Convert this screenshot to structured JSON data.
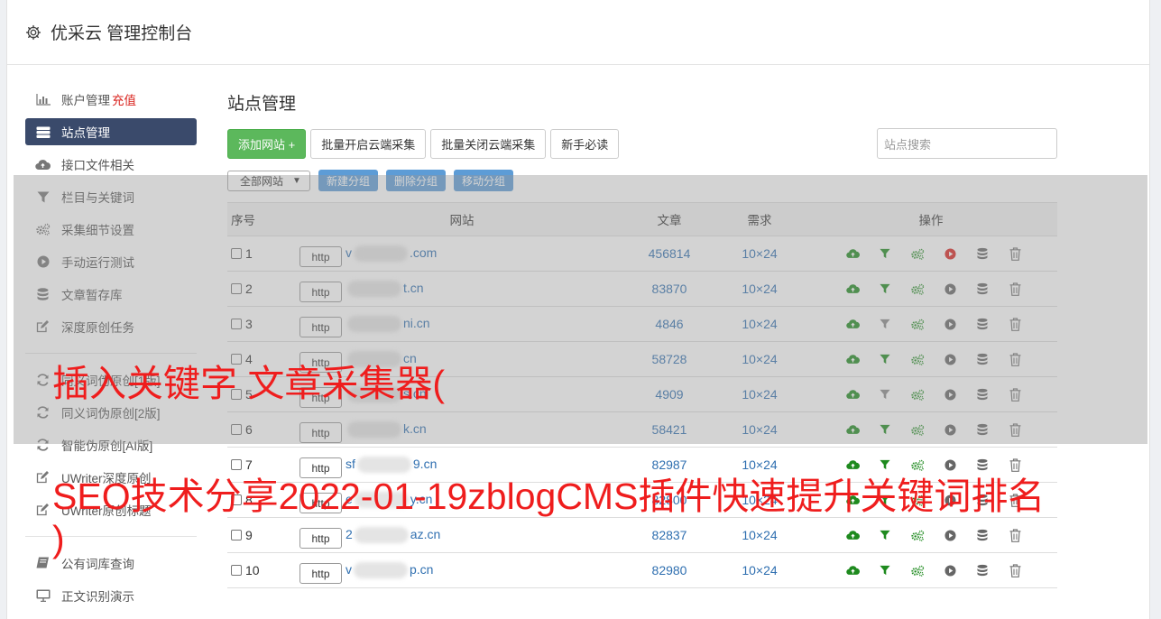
{
  "header": {
    "title": "优采云 管理控制台"
  },
  "sidebar": {
    "items": [
      {
        "label": "账户管理",
        "extra": "充值",
        "icon": "bar-chart-icon"
      },
      {
        "label": "站点管理",
        "icon": "server-icon",
        "active": true
      },
      {
        "label": "接口文件相关",
        "icon": "cloud-upload-icon"
      },
      {
        "label": "栏目与关键词",
        "icon": "filter-icon"
      },
      {
        "label": "采集细节设置",
        "icon": "cogs-icon"
      },
      {
        "label": "手动运行测试",
        "icon": "play-circle-icon"
      },
      {
        "label": "文章暂存库",
        "icon": "database-icon"
      },
      {
        "label": "深度原创任务",
        "icon": "edit-icon"
      }
    ],
    "items2": [
      {
        "label": "同义词伪原创[1版]",
        "icon": "refresh-icon"
      },
      {
        "label": "同义词伪原创[2版]",
        "icon": "refresh-icon"
      },
      {
        "label": "智能伪原创[AI版]",
        "icon": "refresh-icon"
      },
      {
        "label": "UWriter深度原创",
        "icon": "edit-icon"
      },
      {
        "label": "UWriter原创标题",
        "icon": "edit-icon"
      }
    ],
    "items3": [
      {
        "label": "公有词库查询",
        "icon": "book-icon"
      },
      {
        "label": "正文识别演示",
        "icon": "monitor-icon"
      }
    ]
  },
  "main": {
    "title": "站点管理",
    "toolbar": {
      "add_site": "添加网站 +",
      "batch_open": "批量开启云端采集",
      "batch_close": "批量关闭云端采集",
      "newbie": "新手必读",
      "search_placeholder": "站点搜索"
    },
    "group": {
      "select_value": "全部网站",
      "new_group": "新建分组",
      "delete_group": "删除分组",
      "move_group": "移动分组"
    },
    "table": {
      "headers": {
        "no": "序号",
        "site": "网站",
        "articles": "文章",
        "demand": "需求",
        "ops": "操作"
      },
      "rows": [
        {
          "no": "1",
          "protocol": "http",
          "prefix": "v",
          "suffix": ".com",
          "articles": "456814",
          "demand": "10×24",
          "running": true,
          "filter_on": true
        },
        {
          "no": "2",
          "protocol": "http",
          "prefix": "",
          "suffix": "t.cn",
          "articles": "83870",
          "demand": "10×24",
          "running": false,
          "filter_on": true
        },
        {
          "no": "3",
          "protocol": "http",
          "prefix": "",
          "suffix": "ni.cn",
          "articles": "4846",
          "demand": "10×24",
          "running": false,
          "filter_on": false
        },
        {
          "no": "4",
          "protocol": "http",
          "prefix": "",
          "suffix": "cn",
          "articles": "58728",
          "demand": "10×24",
          "running": false,
          "filter_on": true
        },
        {
          "no": "5",
          "protocol": "http",
          "prefix": "",
          "suffix": "s.cn",
          "articles": "4909",
          "demand": "10×24",
          "running": false,
          "filter_on": false
        },
        {
          "no": "6",
          "protocol": "http",
          "prefix": "",
          "suffix": "k.cn",
          "articles": "58421",
          "demand": "10×24",
          "running": false,
          "filter_on": true
        },
        {
          "no": "7",
          "protocol": "http",
          "prefix": "sf",
          "suffix": "9.cn",
          "articles": "82987",
          "demand": "10×24",
          "running": false,
          "filter_on": true
        },
        {
          "no": "8",
          "protocol": "http",
          "prefix": "e",
          "suffix": "y.cn",
          "articles": "82800",
          "demand": "10×24",
          "running": false,
          "filter_on": true
        },
        {
          "no": "9",
          "protocol": "http",
          "prefix": "2",
          "suffix": "az.cn",
          "articles": "82837",
          "demand": "10×24",
          "running": false,
          "filter_on": true
        },
        {
          "no": "10",
          "protocol": "http",
          "prefix": "v",
          "suffix": "p.cn",
          "articles": "82980",
          "demand": "10×24",
          "running": false,
          "filter_on": true
        }
      ]
    }
  },
  "overlay_caption": {
    "line1": "插入关键字 文章采集器(",
    "line2": "SEO技术分享2022-01-19zblogCMS插件快速提升关键词排名",
    "line3": ")"
  },
  "colors": {
    "active_nav": "#3a4a6b",
    "add_button": "#5cb85c",
    "small_button": "#5d9cd6",
    "link": "#2f6fb0",
    "caption": "#ef1d1d",
    "run_active": "#d9241f",
    "ops_green": "#1e8a1e"
  }
}
